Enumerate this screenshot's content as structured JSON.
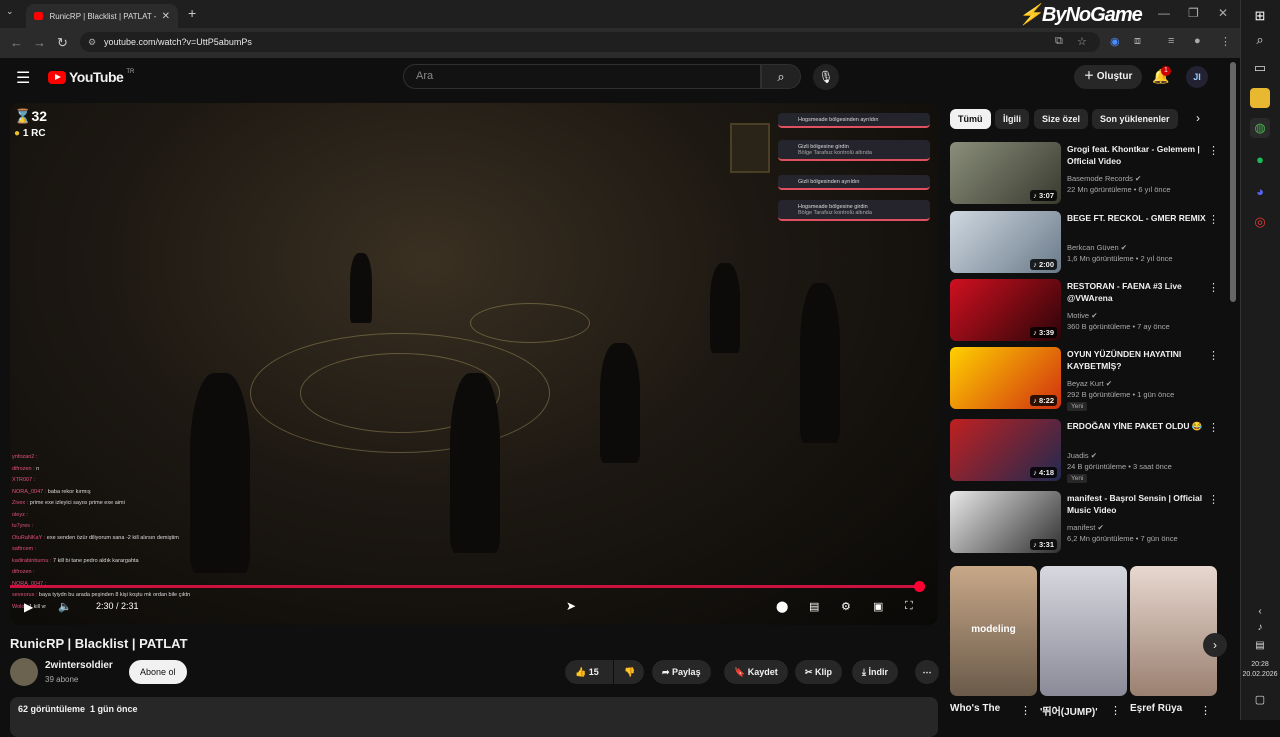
{
  "browser": {
    "tab_title": "RunicRP | Blacklist | PATLAT - Yo",
    "url": "youtube.com/watch?v=UttP5abumPs",
    "brand_overlay": "ByNoGame"
  },
  "yt_header": {
    "logo_text": "YouTube",
    "country": "TR",
    "search_placeholder": "Ara",
    "create_label": "Oluştur",
    "notification_count": "1",
    "avatar_initials": "JI"
  },
  "player": {
    "hud_count": "32",
    "hud_rc": "1 RC",
    "time": "2:30 / 2:31",
    "progress_fraction": 0.99,
    "notifications": [
      {
        "title": "Hogsmeade bölgesinden ayrıldın",
        "sub": ""
      },
      {
        "title": "Gizli bölgesine girdin",
        "sub": "Bölge Tarafsız kontrolü altında"
      },
      {
        "title": "Gizli bölgesinden ayrıldın",
        "sub": ""
      },
      {
        "title": "Hogsmeade bölgesine girdin",
        "sub": "Bölge Tarafsız kontrolü altında"
      }
    ],
    "chat": [
      {
        "name": "ynfozan2 :",
        "msg": ""
      },
      {
        "name": "difrozen :",
        "msg": "n"
      },
      {
        "name": "XTR007 :",
        "msg": ""
      },
      {
        "name": "NORA_0047 :",
        "msg": "baba rekor kırmış"
      },
      {
        "name": "Zivex :",
        "msg": "prime exe izleyici sayısı prime exe aimi"
      },
      {
        "name": "oleyz :",
        "msg": ""
      },
      {
        "name": "tu7yres :",
        "msg": ""
      },
      {
        "name": "OtuRaNKaY :",
        "msg": "exe senden özür diliyorum sana -2 kill alırsın demiştim"
      },
      {
        "name": "saftrcem :",
        "msg": ""
      },
      {
        "name": "kadirabinburnu :",
        "msg": "7 kill bi tane pedro aldık karargahta"
      },
      {
        "name": "difrozen :",
        "msg": ""
      },
      {
        "name": "NORA_0047 :",
        "msg": ""
      },
      {
        "name": "seveorus :",
        "msg": "baya tyiydn bu arada peşinden 8 kişi koştu mk ordan bile çıktn"
      },
      {
        "name": "Wolo :",
        "msg": "1 kill vr"
      }
    ]
  },
  "video": {
    "title": "RunicRP | Blacklist | PATLAT",
    "channel": "2wintersoldier",
    "subscribers": "39 abone",
    "subscribe_label": "Abone ol",
    "likes": "15",
    "share_label": "Paylaş",
    "save_label": "Kaydet",
    "clip_label": "Klip",
    "download_label": "İndir",
    "views": "62 görüntüleme",
    "age": "1 gün önce"
  },
  "sidebar": {
    "chips": [
      "Tümü",
      "İlgili",
      "Size özel",
      "Son yüklenenler"
    ],
    "recommendations": [
      {
        "title": "Grogi feat. Khontkar - Gelemem | Official Video",
        "channel": "Basemode Records",
        "meta": "22 Mn görüntüleme • 6 yıl önce",
        "duration": "3:07",
        "new": "",
        "c1": "#8a8f7a",
        "c2": "#3a3a30"
      },
      {
        "title": "BEGE FT. RECKOL - GMER REMIX",
        "channel": "Berkcan Güven",
        "meta": "1,6 Mn görüntüleme • 2 yıl önce",
        "duration": "2:00",
        "new": "",
        "c1": "#cfd8e0",
        "c2": "#6a7a8a"
      },
      {
        "title": "RESTORAN - FAENA #3 Live @VWArena",
        "channel": "Motive",
        "meta": "360 B görüntüleme • 7 ay önce",
        "duration": "3:39",
        "new": "",
        "c1": "#d01020",
        "c2": "#2a0508"
      },
      {
        "title": "OYUN YÜZÜNDEN HAYATINI KAYBETMİŞ?",
        "channel": "Beyaz Kurt",
        "meta": "292 B görüntüleme • 1 gün önce",
        "duration": "8:22",
        "new": "Yeni",
        "c1": "#ffd000",
        "c2": "#d03010"
      },
      {
        "title": "ERDOĞAN YİNE PAKET OLDU 😂",
        "channel": "Juadis",
        "meta": "24 B görüntüleme • 3 saat önce",
        "duration": "4:18",
        "new": "Yeni",
        "c1": "#c02020",
        "c2": "#202a50"
      },
      {
        "title": "manifest - Başrol Sensin | Official Music Video",
        "channel": "manifest",
        "meta": "6,2 Mn görüntüleme • 7 gün önce",
        "duration": "3:31",
        "new": "",
        "c1": "#e8e8e8",
        "c2": "#303030"
      }
    ],
    "shorts": [
      {
        "title": "Who's The",
        "overlay": "modeling",
        "c1": "#c8a888",
        "c2": "#6a5a4a"
      },
      {
        "title": "'뛰어(JUMP)'",
        "overlay": "",
        "c1": "#d8d8e0",
        "c2": "#8a8a98"
      },
      {
        "title": "Eşref Rüya",
        "overlay": "",
        "c1": "#e8d8d0",
        "c2": "#9a8070"
      }
    ]
  },
  "taskbar": {
    "time": "20:28",
    "date": "20.02.2026"
  }
}
